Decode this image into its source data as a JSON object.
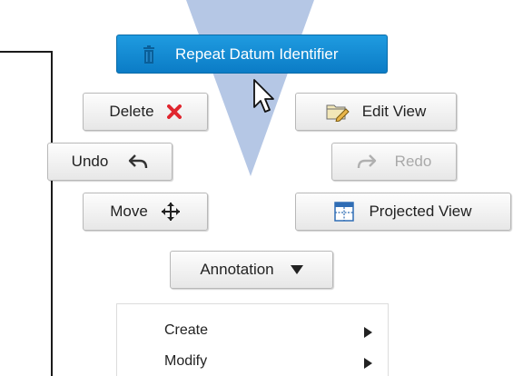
{
  "radial_menu": {
    "top_action": {
      "label": "Repeat Datum Identifier",
      "icon": "trash-icon"
    },
    "delete": {
      "label": "Delete",
      "icon": "red-x-icon"
    },
    "edit_view": {
      "label": "Edit View",
      "icon": "folder-edit-icon"
    },
    "undo": {
      "label": "Undo",
      "icon": "undo-arrow-icon"
    },
    "redo": {
      "label": "Redo",
      "icon": "redo-arrow-icon",
      "enabled": false
    },
    "move": {
      "label": "Move",
      "icon": "move-arrows-icon"
    },
    "projected_view": {
      "label": "Projected View",
      "icon": "projected-view-icon"
    },
    "annotation": {
      "label": "Annotation",
      "icon": "dropdown-triangle-icon"
    }
  },
  "overflow_menu": {
    "items": [
      {
        "label": "Create",
        "submenu": true
      },
      {
        "label": "Modify",
        "submenu": true
      }
    ]
  },
  "colors": {
    "primary": "#1589d3",
    "delete_icon": "#e0262f",
    "wedge": "#a8bde0",
    "bracket": "#1a1a1a"
  }
}
